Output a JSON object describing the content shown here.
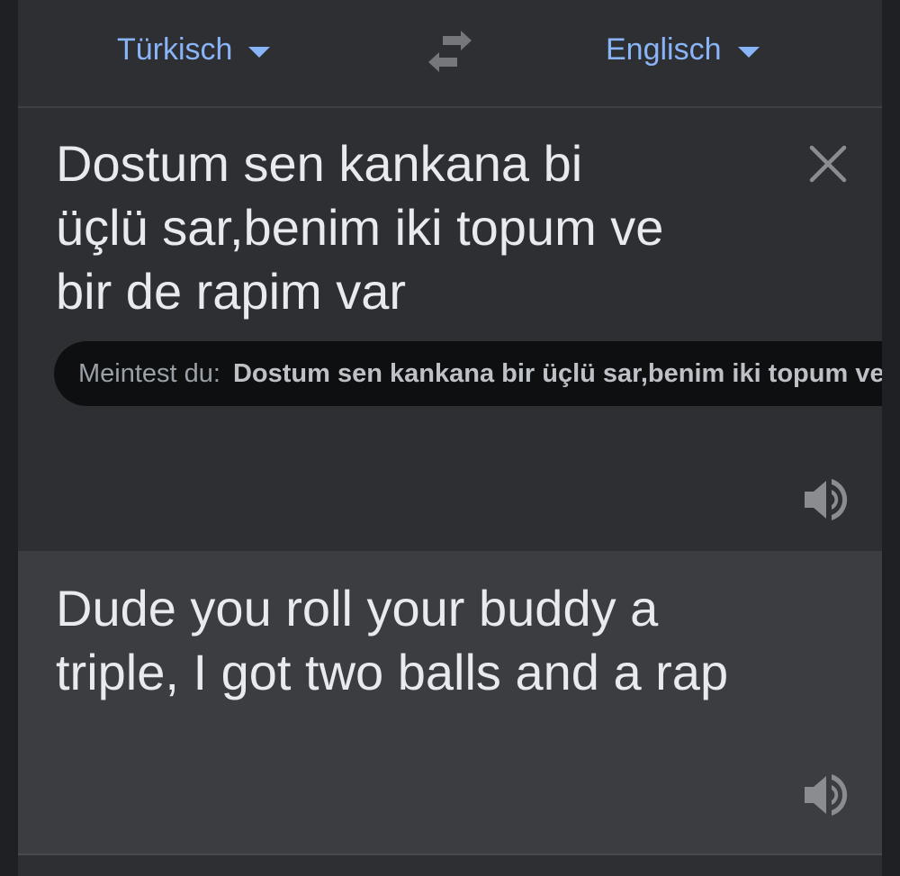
{
  "header": {
    "source_language": "Türkisch",
    "target_language": "Englisch",
    "source_caret_icon": "caret-down-icon",
    "target_caret_icon": "caret-down-icon",
    "swap_icon": "swap-arrows-icon"
  },
  "source": {
    "line1": "Dostum sen kankana bi",
    "line2": "üçlü sar,benim iki topum ve",
    "line3": "bir de rapim var",
    "clear_icon": "close-icon",
    "speaker_icon": "speaker-icon"
  },
  "suggestion": {
    "label": "Meintest du:",
    "text": "Dostum sen kankana bir üçlü sar,benim iki topum ve bir de rapim var"
  },
  "translation": {
    "line1": "Dude you roll your buddy a",
    "line2": "triple, I got two balls and a rap",
    "speaker_icon": "speaker-icon"
  },
  "colors": {
    "accent": "#8ab4f8",
    "text": "#e8eaed",
    "muted": "#9aa0a6",
    "source_bg": "#2e2f33",
    "target_bg": "#3c3d41",
    "suggestion_bg": "#0e0f10"
  }
}
